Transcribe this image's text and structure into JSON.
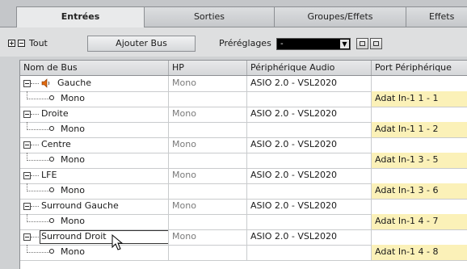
{
  "tabs": [
    "Entrées",
    "Sorties",
    "Groupes/Effets",
    "Effets"
  ],
  "toolbar": {
    "all_label": "Tout",
    "add_bus_label": "Ajouter Bus",
    "presets_label": "Préréglages",
    "preset_value": "-"
  },
  "columns": [
    "Nom de Bus",
    "HP",
    "Périphérique Audio",
    "Port Périphérique"
  ],
  "rows": [
    {
      "name": "Gauche",
      "hp": "Mono",
      "device": "ASIO 2.0 - VSL2020",
      "sub_name": "Mono",
      "port": "Adat In-1 1 - 1",
      "speaker": true,
      "editing": false
    },
    {
      "name": "Droite",
      "hp": "Mono",
      "device": "ASIO 2.0 - VSL2020",
      "sub_name": "Mono",
      "port": "Adat In-1 1 - 2",
      "speaker": false,
      "editing": false
    },
    {
      "name": "Centre",
      "hp": "Mono",
      "device": "ASIO 2.0 - VSL2020",
      "sub_name": "Mono",
      "port": "Adat In-1 3 - 5",
      "speaker": false,
      "editing": false
    },
    {
      "name": "LFE",
      "hp": "Mono",
      "device": "ASIO 2.0 - VSL2020",
      "sub_name": "Mono",
      "port": "Adat In-1 3 - 6",
      "speaker": false,
      "editing": false
    },
    {
      "name": "Surround Gauche",
      "hp": "Mono",
      "device": "ASIO 2.0 - VSL2020",
      "sub_name": "Mono",
      "port": "Adat In-1 4 - 7",
      "speaker": false,
      "editing": false
    },
    {
      "name": "Surround Droit",
      "hp": "Mono",
      "device": "ASIO 2.0 - VSL2020",
      "sub_name": "Mono",
      "port": "Adat In-1 4 - 8",
      "speaker": false,
      "editing": true
    }
  ],
  "colors": {
    "port_highlight": "#fbf1b8",
    "speaker_icon": "#e06a10"
  },
  "icons": [
    "expand-all-icon",
    "collapse-all-icon",
    "speaker-icon",
    "mouse-cursor-icon",
    "save-preset-icon",
    "delete-preset-icon"
  ]
}
